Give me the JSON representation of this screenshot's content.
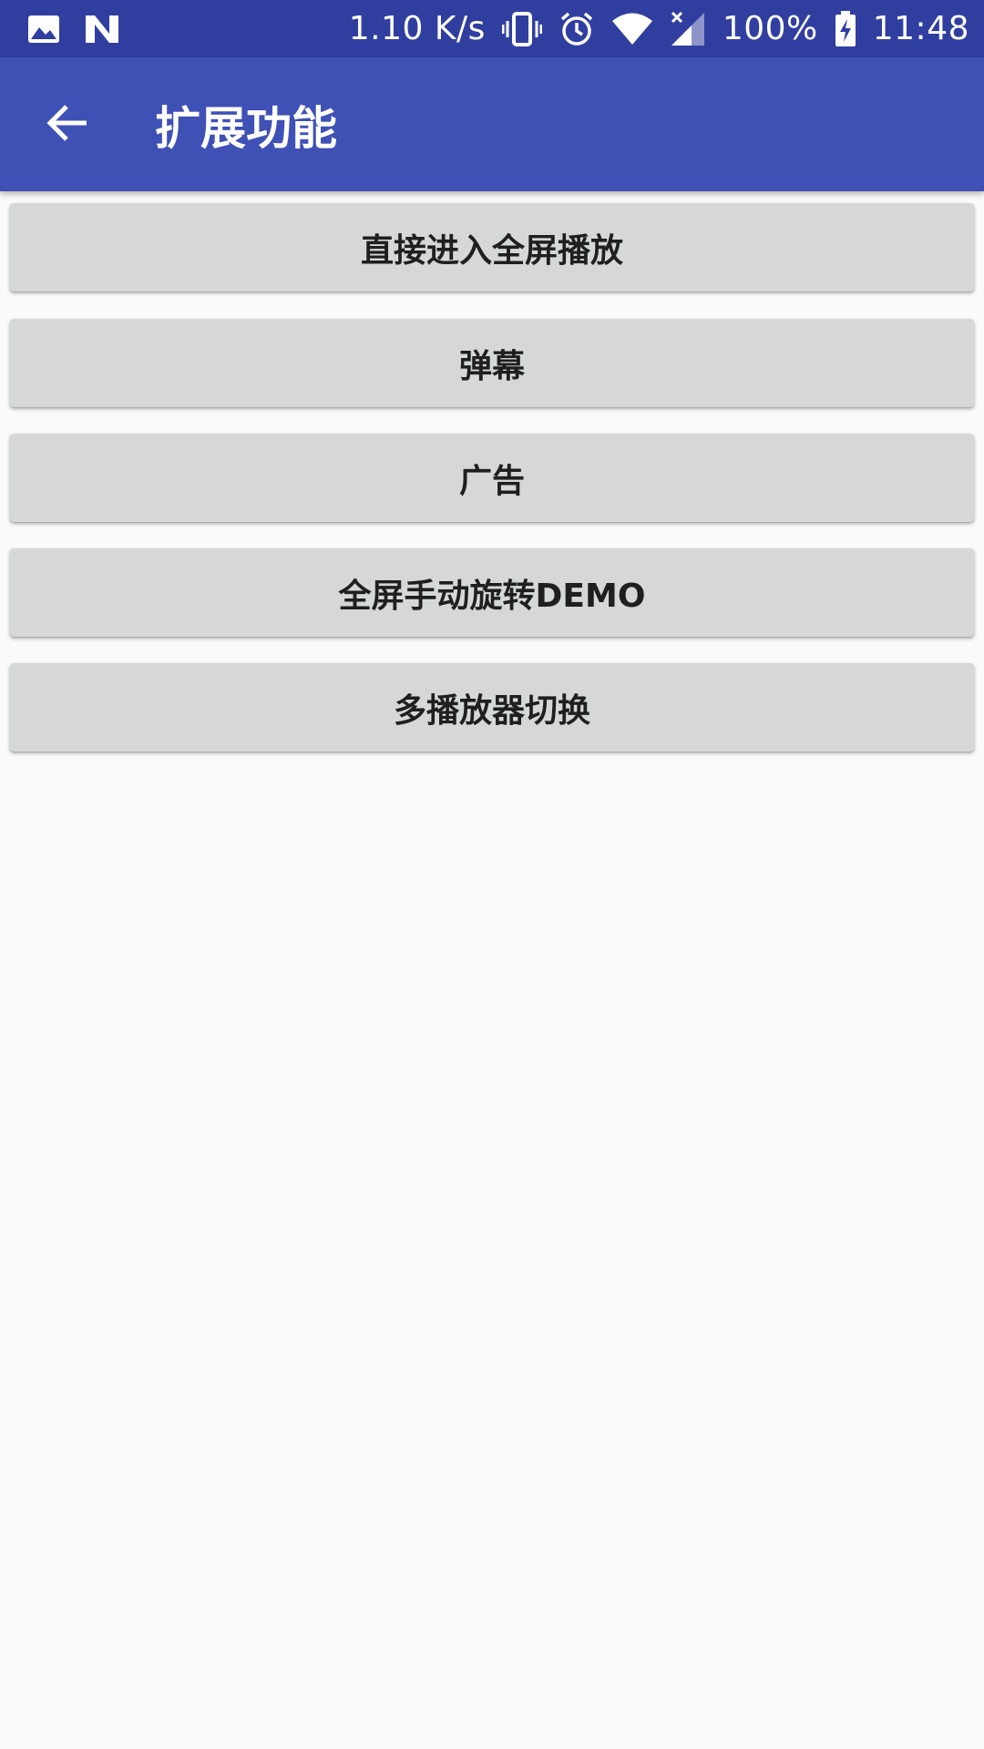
{
  "status_bar": {
    "net_speed": "1.10 K/s",
    "battery": "100%",
    "time": "11:48",
    "icons": [
      "image-icon",
      "n-icon",
      "vibrate-icon",
      "alarm-icon",
      "wifi-icon",
      "signal-icon",
      "battery-icon"
    ]
  },
  "app_bar": {
    "back_icon": "arrow-left-icon",
    "title": "扩展功能"
  },
  "buttons": [
    {
      "label": "直接进入全屏播放"
    },
    {
      "label": "弹幕"
    },
    {
      "label": "广告"
    },
    {
      "label": "全屏手动旋转DEMO"
    },
    {
      "label": "多播放器切换"
    }
  ],
  "colors": {
    "status_bar": "#303f9f",
    "app_bar": "#3f51b5",
    "button": "#d6d7d7",
    "background": "#fafafa"
  }
}
